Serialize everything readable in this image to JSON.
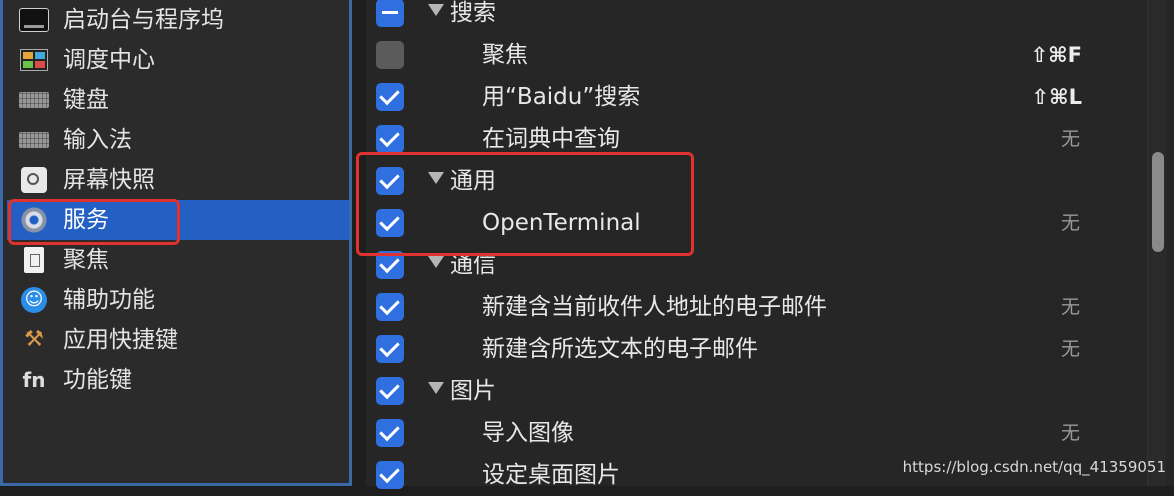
{
  "sidebar": {
    "items": [
      {
        "label": "启动台与程序坞",
        "icon": "launchpad-icon"
      },
      {
        "label": "调度中心",
        "icon": "mission-control-icon"
      },
      {
        "label": "键盘",
        "icon": "keyboard-icon"
      },
      {
        "label": "输入法",
        "icon": "keyboard-icon"
      },
      {
        "label": "屏幕快照",
        "icon": "screenshot-icon"
      },
      {
        "label": "服务",
        "icon": "gear-icon",
        "selected": true
      },
      {
        "label": "聚焦",
        "icon": "spotlight-icon"
      },
      {
        "label": "辅助功能",
        "icon": "accessibility-icon"
      },
      {
        "label": "应用快捷键",
        "icon": "app-shortcuts-icon"
      },
      {
        "label": "功能键",
        "icon": "fn-icon",
        "icon_text": "fn"
      }
    ]
  },
  "services": {
    "rows": [
      {
        "type": "group",
        "label": "搜索",
        "state": "mixed"
      },
      {
        "type": "item",
        "label": "聚焦",
        "state": "unchecked",
        "shortcut": "⇧⌘F"
      },
      {
        "type": "item",
        "label": "用“Baidu”搜索",
        "state": "checked",
        "shortcut": "⇧⌘L"
      },
      {
        "type": "item",
        "label": "在词典中查询",
        "state": "checked",
        "shortcut": "无"
      },
      {
        "type": "group",
        "label": "通用",
        "state": "checked"
      },
      {
        "type": "item",
        "label": "OpenTerminal",
        "state": "checked",
        "shortcut": "无"
      },
      {
        "type": "group",
        "label": "通信",
        "state": "checked"
      },
      {
        "type": "item",
        "label": "新建含当前收件人地址的电子邮件",
        "state": "checked",
        "shortcut": "无"
      },
      {
        "type": "item",
        "label": "新建含所选文本的电子邮件",
        "state": "checked",
        "shortcut": "无"
      },
      {
        "type": "group",
        "label": "图片",
        "state": "checked"
      },
      {
        "type": "item",
        "label": "导入图像",
        "state": "checked",
        "shortcut": "无"
      },
      {
        "type": "item",
        "label": "设定桌面图片",
        "state": "checked",
        "shortcut": ""
      }
    ]
  },
  "watermark": "https://blog.csdn.net/qq_41359051",
  "colors": {
    "selection": "#2460c4",
    "checkbox": "#2f6fe0",
    "highlight_box": "#e0322e"
  }
}
